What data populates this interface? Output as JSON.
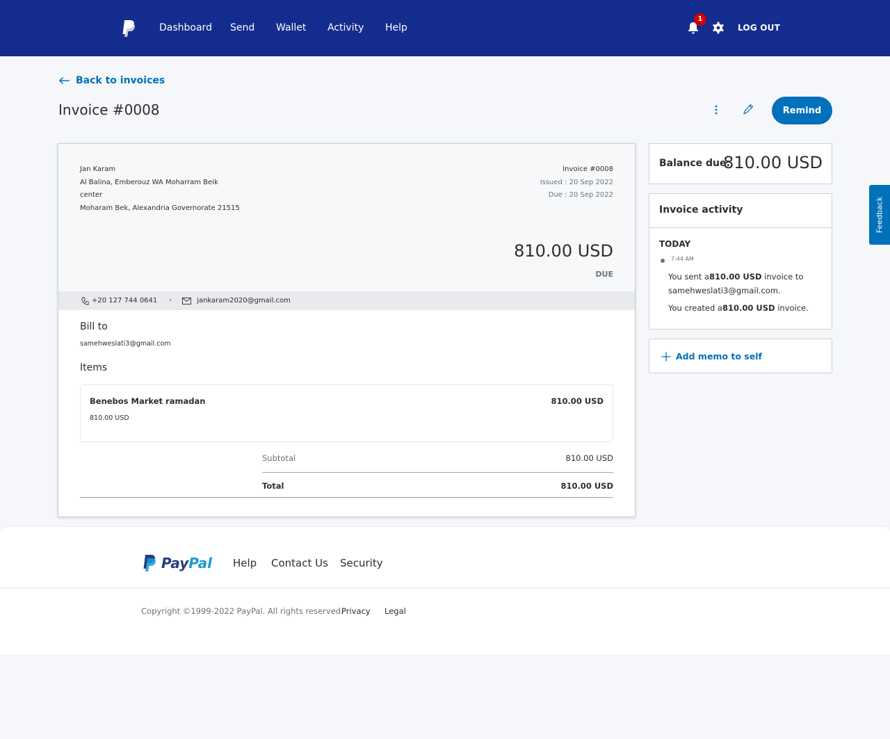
{
  "nav": {
    "items": [
      {
        "label": "Dashboard"
      },
      {
        "label": "Send"
      },
      {
        "label": "Wallet"
      },
      {
        "label": "Activity"
      },
      {
        "label": "Help"
      }
    ],
    "notification_count": "1",
    "logout_label": "LOG OUT"
  },
  "page": {
    "back_label": "Back to invoices",
    "title": "Invoice #0008",
    "remind_label": "Remind"
  },
  "invoice": {
    "from": {
      "name": "Jan Karam",
      "address_line1": "Al Balina, Emberouz WA Moharram Beik",
      "address_line2": "center",
      "address_line3": "Moharam Bek, Alexandria Governorate 21515"
    },
    "number": "Invoice #0008",
    "issued": "Issued : 20 Sep 2022",
    "due_date": "Due : 20 Sep 2022",
    "amount": "810.00 USD",
    "status": "DUE",
    "phone": "+20 127 744 0641",
    "email": "jankaram2020@gmail.com",
    "bill_to_label": "Bill to",
    "bill_to_email": "samehweslati3@gmail.com",
    "items_label": "Items",
    "items": [
      {
        "name": "Benebos Market ramadan",
        "unit_price": "810.00 USD",
        "amount": "810.00 USD"
      }
    ],
    "subtotal_label": "Subtotal",
    "subtotal": "810.00 USD",
    "total_label": "Total",
    "total": "810.00 USD"
  },
  "balance": {
    "label": "Balance due:",
    "value": "810.00 USD"
  },
  "activity": {
    "title": "Invoice activity",
    "day": "TODAY",
    "time": "7:44 AM",
    "sent_prefix": "You sent a",
    "sent_amount": "810.00 USD",
    "sent_suffix": " invoice to samehweslati3@gmail.com.",
    "created_prefix": "You created a",
    "created_amount": "810.00 USD",
    "created_suffix": " invoice."
  },
  "memo": {
    "label": "Add memo to self"
  },
  "feedback": {
    "label": "Feedback"
  },
  "footer": {
    "brand_a": "Pay",
    "brand_b": "Pal",
    "links": [
      "Help",
      "Contact Us",
      "Security"
    ],
    "copyright": "Copyright ©1999-2022 PayPal. All rights reserved.",
    "privacy": "Privacy",
    "legal": "Legal"
  },
  "colors": {
    "nav_bg": "#142c8e",
    "accent": "#0070ba",
    "badge": "#d20000"
  }
}
